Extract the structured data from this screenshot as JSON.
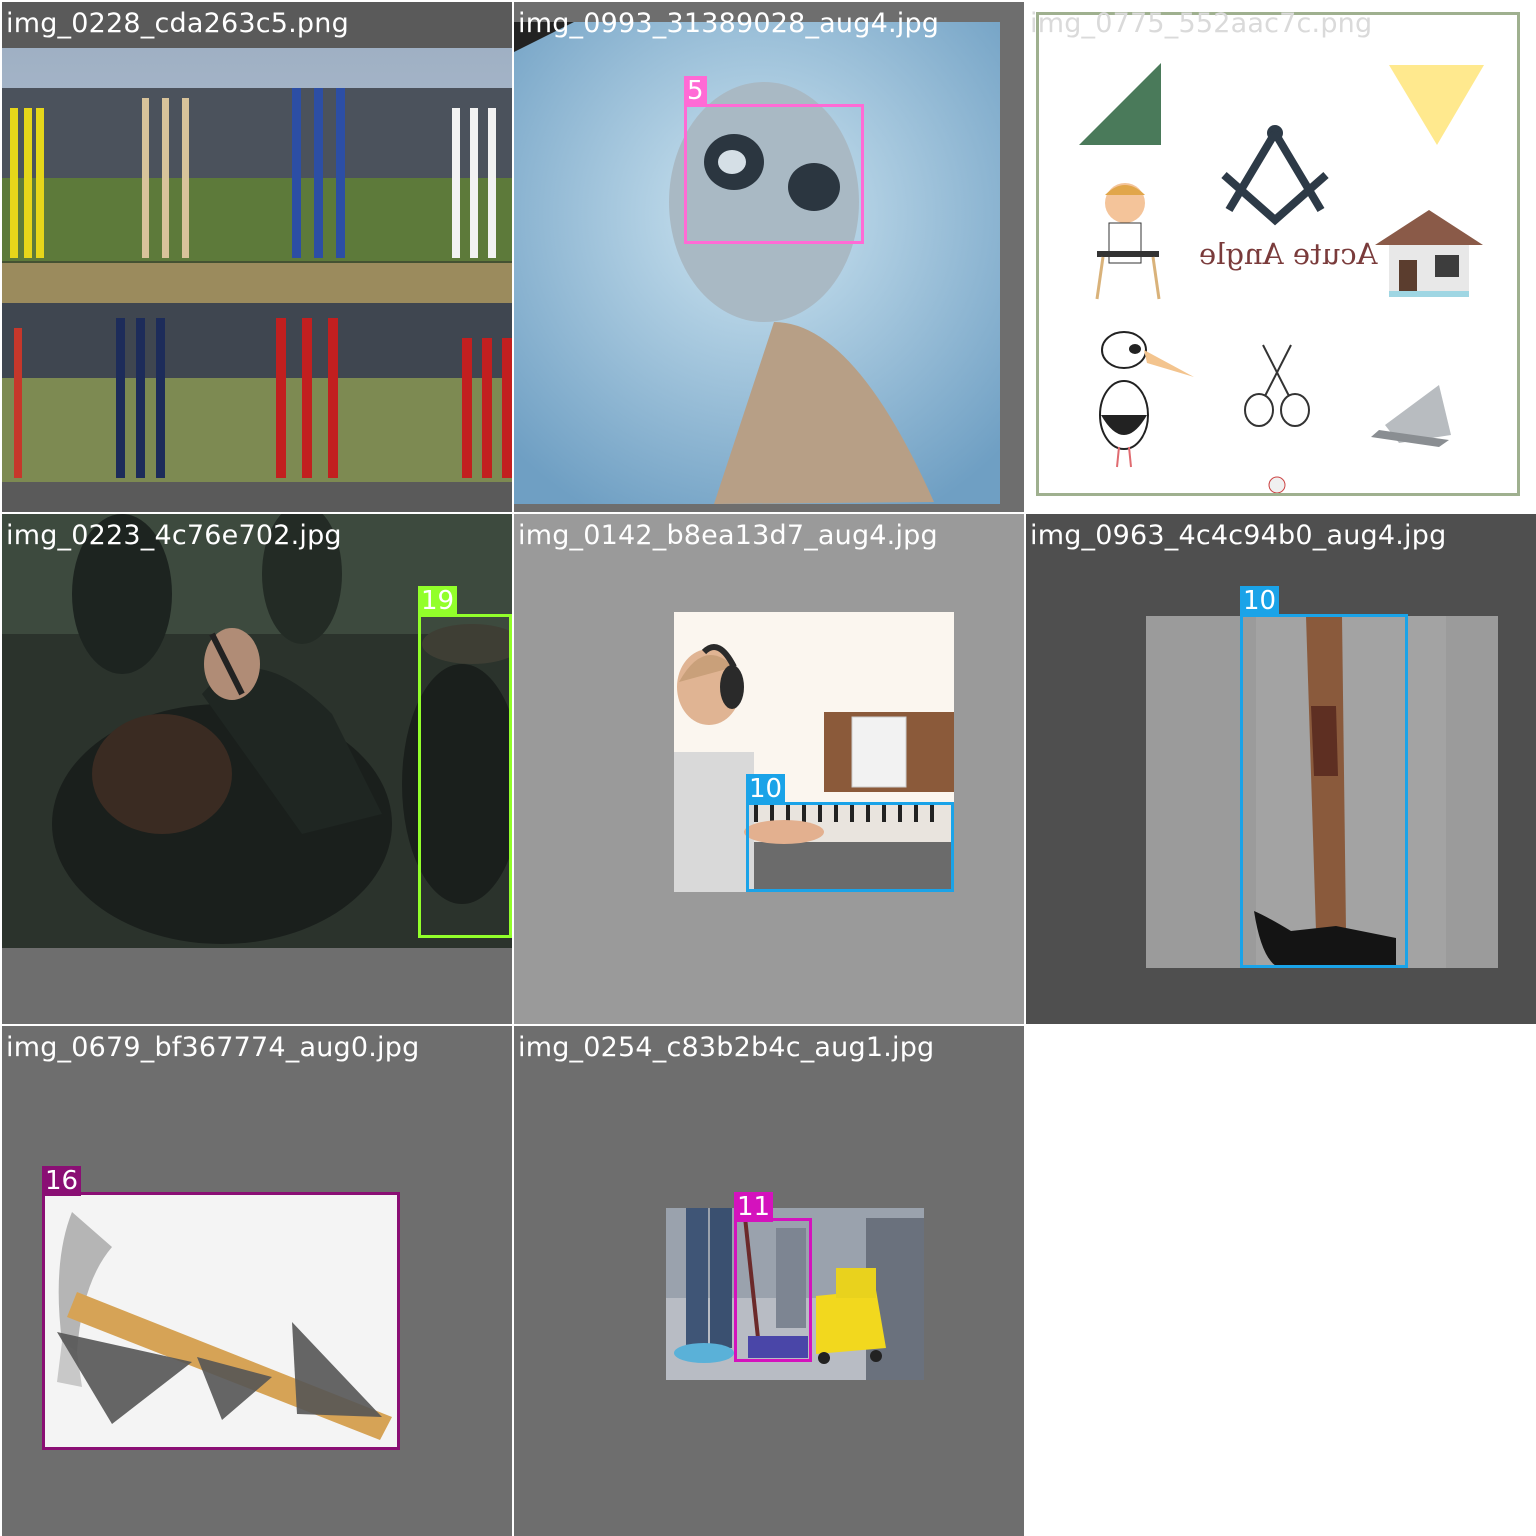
{
  "tiles": [
    {
      "title": "img_0228_cda263c5.png",
      "boxes": []
    },
    {
      "title": "img_0993_31389028_aug4.jpg",
      "boxes": [
        {
          "label": "5",
          "color": "#ff6ad5"
        }
      ]
    },
    {
      "title": "img_0775_552aac7c.png",
      "boxes": [],
      "caption": "Acute Angle"
    },
    {
      "title": "img_0223_4c76e702.jpg",
      "boxes": [
        {
          "label": "19",
          "color": "#92ff2a"
        }
      ]
    },
    {
      "title": "img_0142_b8ea13d7_aug4.jpg",
      "boxes": [
        {
          "label": "10",
          "color": "#1aa3e8"
        }
      ]
    },
    {
      "title": "img_0963_4c4c94b0_aug4.jpg",
      "boxes": [
        {
          "label": "10",
          "color": "#1aa3e8"
        }
      ]
    },
    {
      "title": "img_0679_bf367774_aug0.jpg",
      "boxes": [
        {
          "label": "16",
          "color": "#8a0f74"
        }
      ]
    },
    {
      "title": "img_0254_c83b2b4c_aug1.jpg",
      "boxes": [
        {
          "label": "11",
          "color": "#d412bd"
        }
      ]
    }
  ]
}
